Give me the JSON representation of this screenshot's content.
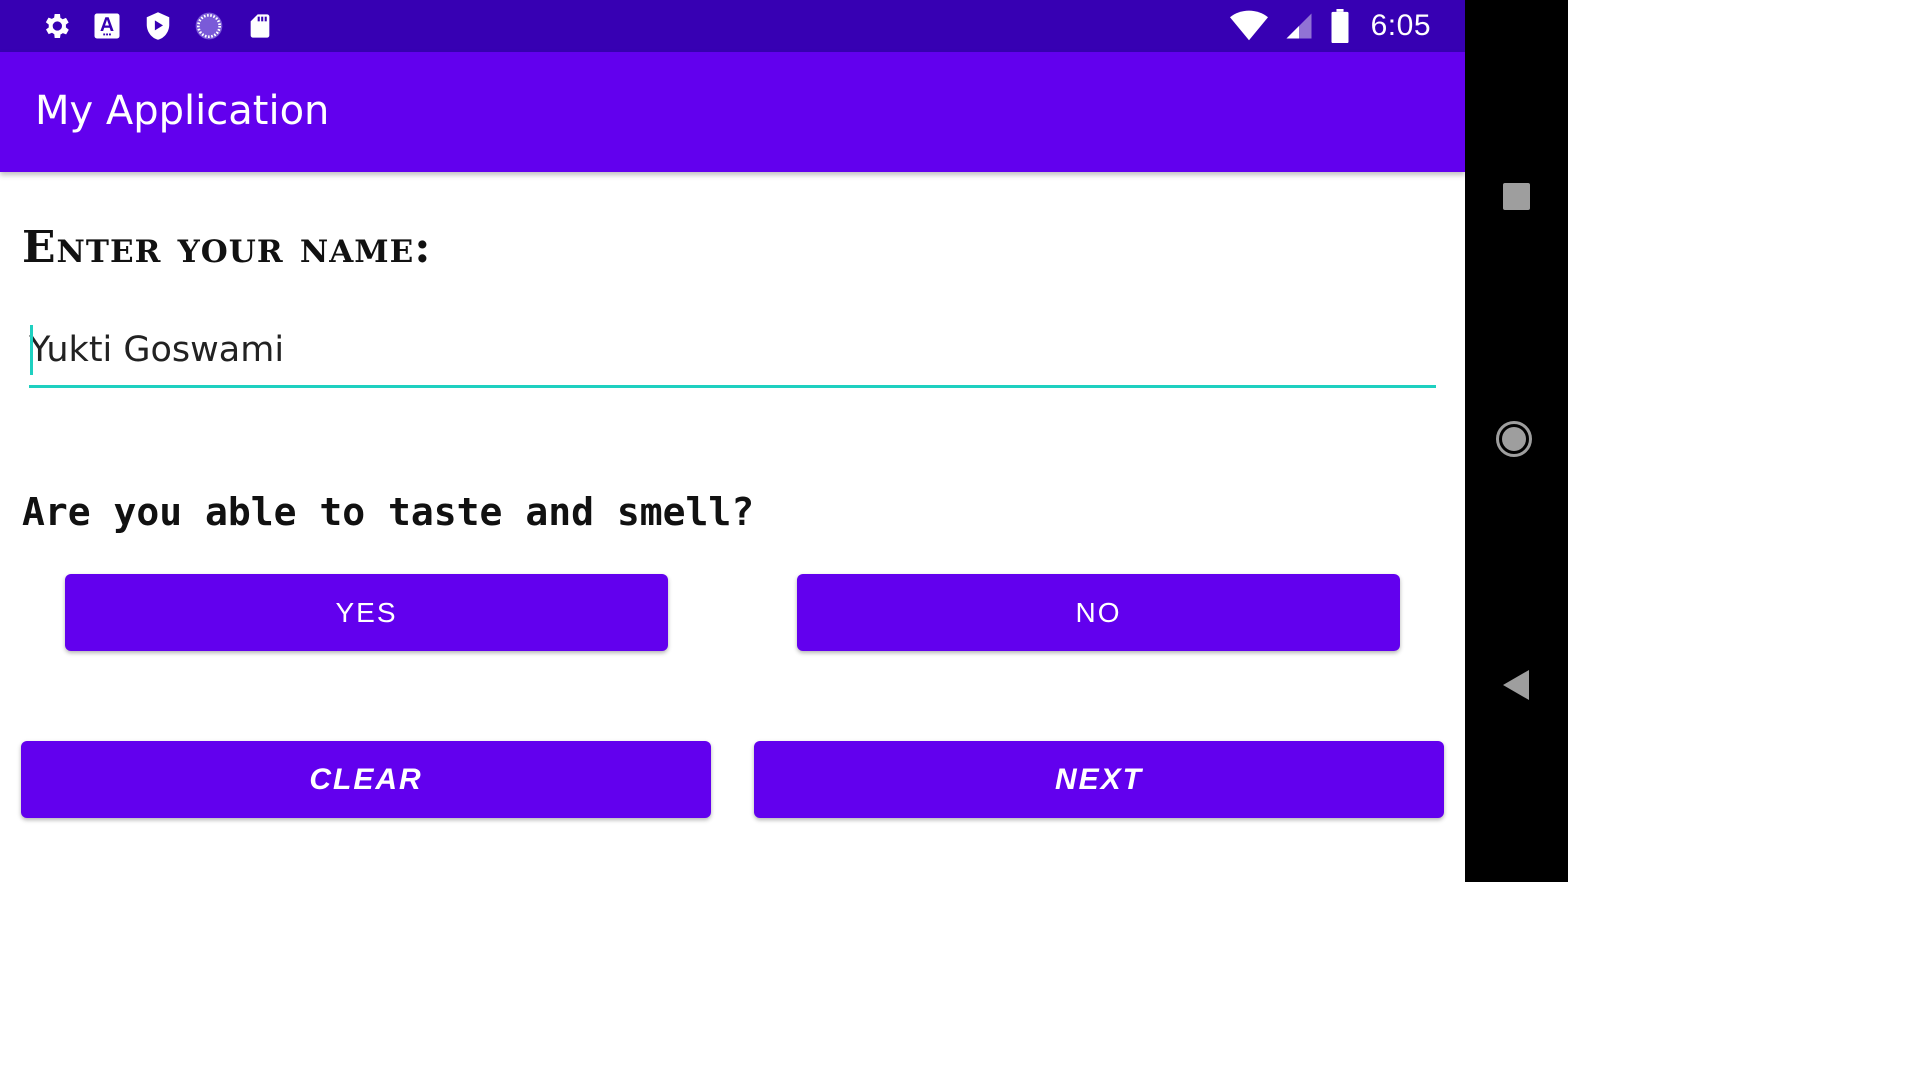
{
  "status_bar": {
    "time": "6:05",
    "left_icons": [
      "gear-icon",
      "text-a-icon",
      "shield-play-icon",
      "spinner-icon",
      "sd-card-icon"
    ],
    "right_icons": [
      "wifi-icon",
      "cell-signal-icon",
      "battery-icon"
    ]
  },
  "app_bar": {
    "title": "My Application"
  },
  "form": {
    "name_label": "Enter your name:",
    "name_value": "Yukti Goswami",
    "question": "Are you able to taste and smell?",
    "yes_label": "YES",
    "no_label": "NO",
    "clear_label": "CLEAR",
    "next_label": "NEXT"
  },
  "colors": {
    "status_bar": "#3700B3",
    "primary": "#6200EE",
    "accent": "#1ED0C0",
    "nav_bar": "#000000"
  },
  "nav": {
    "buttons": [
      "recents-icon",
      "home-icon",
      "back-icon"
    ]
  }
}
